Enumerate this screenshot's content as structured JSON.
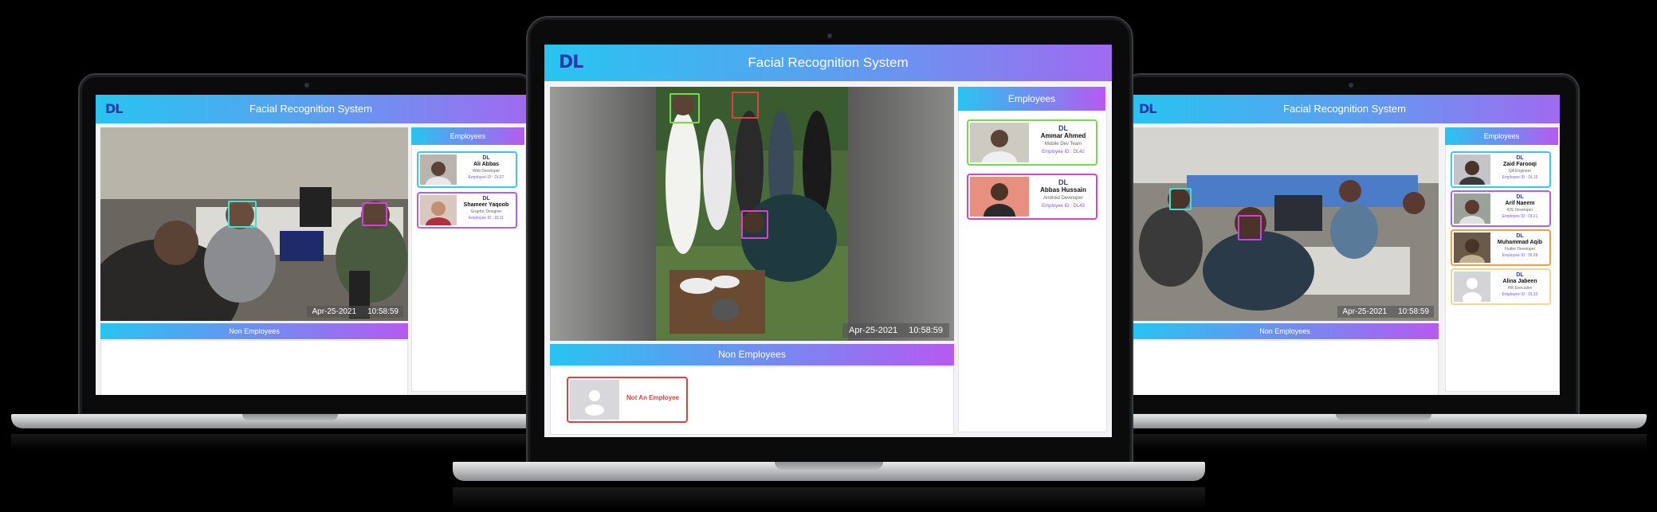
{
  "app": {
    "title": "Facial Recognition System",
    "logo_text": "DL"
  },
  "center": {
    "date": "Apr-25-2021",
    "time": "10:58:59",
    "employees_heading": "Employees",
    "non_employees_heading": "Non Employees",
    "employees": [
      {
        "name": "Ammar Ahmed",
        "role": "Mobile Dev Team",
        "id": "Employee ID : DL42"
      },
      {
        "name": "Abbas Hussain",
        "role": "Android Developer",
        "id": "Employee ID : DL43"
      }
    ],
    "non_employees": [
      {
        "label": "Not An Employee"
      }
    ]
  },
  "left": {
    "date": "Apr-25-2021",
    "time": "10:58:59",
    "employees_heading": "Employees",
    "non_employees_heading": "Non Employees",
    "employees": [
      {
        "name": "Ali Abbas",
        "role": "Web Developer",
        "id": "Employee ID : DL07"
      },
      {
        "name": "Shameer Yaqoob",
        "role": "Graphic Designer",
        "id": "Employee ID : DL11"
      }
    ]
  },
  "right": {
    "date": "Apr-25-2021",
    "time": "10:58:59",
    "employees_heading": "Employees",
    "non_employees_heading": "Non Employees",
    "employees": [
      {
        "name": "Zaid Farooqi",
        "role": "QA Engineer",
        "id": "Employee ID : DL15"
      },
      {
        "name": "Arif Naeem",
        "role": "iOS Developer",
        "id": "Employee ID : DL21"
      },
      {
        "name": "Muhammad Aqib",
        "role": "Flutter Developer",
        "id": "Employee ID : DL28"
      },
      {
        "name": "Alina Jabeen",
        "role": "HR Executive",
        "id": "Employee ID : DL33"
      }
    ]
  },
  "colors": {
    "header_start": "#28c4f0",
    "header_end": "#a06af0",
    "card_green": "#7ad84a",
    "card_pink": "#e040c8",
    "card_cyan": "#38c8f0",
    "card_purple": "#b060f0",
    "card_orange": "#f0a040",
    "card_yellow": "#f0d890",
    "non_employee_border": "#e04040"
  }
}
